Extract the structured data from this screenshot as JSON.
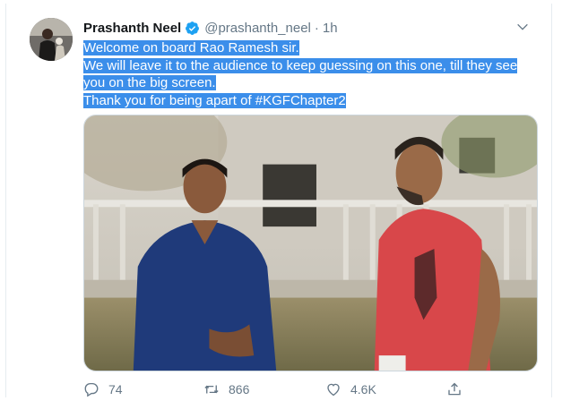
{
  "tweet": {
    "author_name": "Prashanth Neel",
    "handle": "@prashanth_neel",
    "separator": "·",
    "time": "1h",
    "verified": true,
    "text_lines": [
      "Welcome on board Rao Ramesh sir.",
      "We will leave it to the audience to keep guessing on this one, till they see",
      "you on the big screen.",
      "Thank you for being apart of #KGFChapter2"
    ],
    "text_selected": true
  },
  "actions": {
    "reply_count": "74",
    "retweet_count": "866",
    "like_count": "4.6K"
  },
  "icons": {
    "verified": "verified-badge-icon",
    "caret": "chevron-down-icon",
    "reply": "reply-icon",
    "retweet": "retweet-icon",
    "like": "heart-icon",
    "share": "share-icon"
  },
  "colors": {
    "accent": "#1da1f2",
    "selection": "#3b8eea",
    "muted": "#657786"
  }
}
